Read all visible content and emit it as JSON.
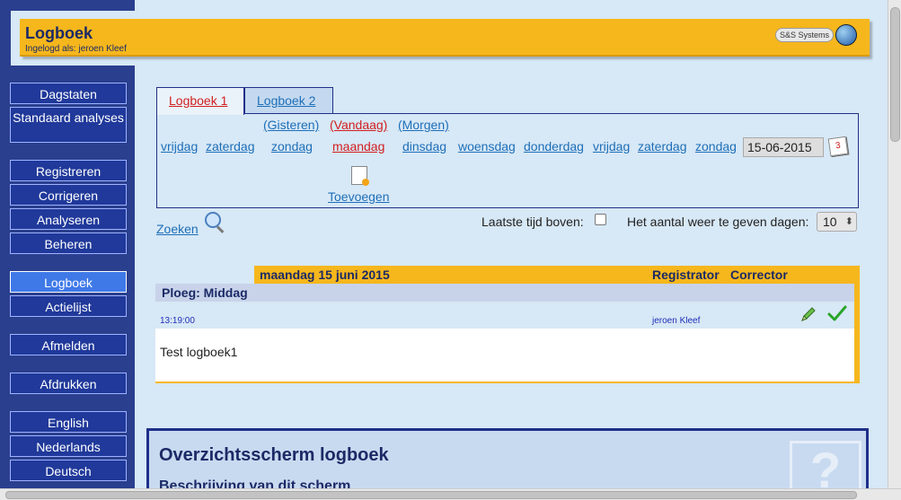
{
  "header": {
    "title": "Logboek",
    "logged_in": "Ingelogd als: jeroen Kleef",
    "brand_text": "S&S Systems"
  },
  "sidebar": {
    "items": [
      {
        "label": "Dagstaten"
      },
      {
        "label": "Standaard analyses"
      },
      {
        "label": "Registreren"
      },
      {
        "label": "Corrigeren"
      },
      {
        "label": "Analyseren"
      },
      {
        "label": "Beheren"
      },
      {
        "label": "Logboek",
        "active": true
      },
      {
        "label": "Actielijst"
      },
      {
        "label": "Afmelden"
      },
      {
        "label": "Afdrukken"
      },
      {
        "label": "English"
      },
      {
        "label": "Nederlands"
      },
      {
        "label": "Deutsch"
      }
    ]
  },
  "tabs": [
    {
      "label": "Logboek 1",
      "active": true
    },
    {
      "label": "Logboek 2",
      "active": false
    }
  ],
  "daynav": {
    "yesterday": "(Gisteren)",
    "today": "(Vandaag)",
    "tomorrow": "(Morgen)",
    "days": [
      "vrijdag",
      "zaterdag",
      "zondag",
      "maandag",
      "dinsdag",
      "woensdag",
      "donderdag",
      "vrijdag",
      "zaterdag",
      "zondag"
    ],
    "current_index": 3,
    "date_value": "15-06-2015",
    "add_label": "Toevoegen"
  },
  "search": {
    "label": "Zoeken",
    "latest_on_top_label": "Laatste tijd boven:",
    "latest_on_top_checked": false,
    "days_label": "Het aantal weer te geven dagen:",
    "days_value": "10"
  },
  "entry": {
    "date_heading": "maandag 15 juni 2015",
    "col_registrator": "Registrator",
    "col_corrector": "Corrector",
    "shift": "Ploeg: Middag",
    "time": "13:19:00",
    "registrator": "jeroen Kleef",
    "text": "Test logboek1"
  },
  "help": {
    "title": "Overzichtsscherm logboek",
    "subtitle": "Beschrijving van dit scherm",
    "icon_text": "?"
  },
  "colors": {
    "accent": "#f6b71d",
    "sidebar": "#2a3f8e",
    "link": "#1e6fb8",
    "today": "#d21f1f"
  }
}
